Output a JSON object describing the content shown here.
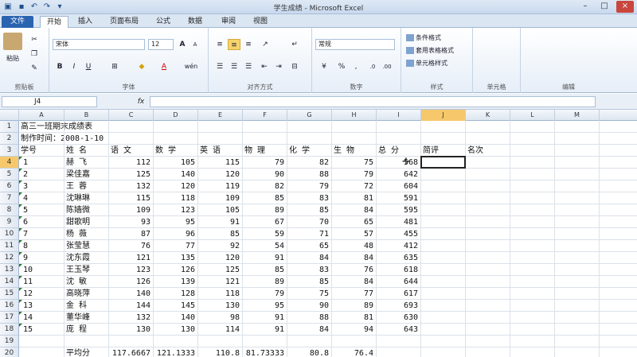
{
  "window": {
    "title": "学生成绩 - Microsoft Excel"
  },
  "tabs": [
    "文件",
    "开始",
    "插入",
    "页面布局",
    "公式",
    "数据",
    "审阅",
    "视图"
  ],
  "ribbon": {
    "clipboard": {
      "paste": "粘贴",
      "label": "剪贴板"
    },
    "font": {
      "name": "宋体",
      "size": "12",
      "bold": "B",
      "italic": "I",
      "underline": "U",
      "grow": "A",
      "shrink": "A",
      "label": "字体",
      "wen": "wén"
    },
    "alignment": {
      "label": "对齐方式"
    },
    "number": {
      "format": "常规",
      "percent": "%",
      "comma": ",",
      "label": "数字"
    },
    "styles": {
      "cond": "条件格式",
      "table": "套用表格格式",
      "cell": "单元格样式",
      "label": "样式"
    },
    "cells": {
      "label": "单元格"
    },
    "editing": {
      "label": "编辑"
    }
  },
  "formula_bar": {
    "name_box": "J4",
    "fx": "fx",
    "formula": ""
  },
  "columns": [
    "A",
    "B",
    "C",
    "D",
    "E",
    "F",
    "G",
    "H",
    "I",
    "J",
    "K",
    "L",
    "M"
  ],
  "rows": [
    {
      "n": "1",
      "A": "高三一班期末成绩表"
    },
    {
      "n": "2",
      "A": "制作时间：2008-1-10"
    },
    {
      "n": "3",
      "A": "学号",
      "B": "姓 名",
      "C": "语 文",
      "D": "数 学",
      "E": "英 语",
      "F": "物 理",
      "G": "化 学",
      "H": "生 物",
      "I": "总 分",
      "J": "简评",
      "K": "名次"
    },
    {
      "n": "4",
      "A": "1",
      "B": "赫  飞",
      "C": "112",
      "D": "105",
      "E": "115",
      "F": "79",
      "G": "82",
      "H": "75",
      "I": "568"
    },
    {
      "n": "5",
      "A": "2",
      "B": "梁佳嘉",
      "C": "125",
      "D": "140",
      "E": "120",
      "F": "90",
      "G": "88",
      "H": "79",
      "I": "642"
    },
    {
      "n": "6",
      "A": "3",
      "B": "王  蓉",
      "C": "132",
      "D": "120",
      "E": "119",
      "F": "82",
      "G": "79",
      "H": "72",
      "I": "604"
    },
    {
      "n": "7",
      "A": "4",
      "B": "沈琳琳",
      "C": "115",
      "D": "118",
      "E": "109",
      "F": "85",
      "G": "83",
      "H": "81",
      "I": "591"
    },
    {
      "n": "8",
      "A": "5",
      "B": "陈嫱微",
      "C": "109",
      "D": "123",
      "E": "105",
      "F": "89",
      "G": "85",
      "H": "84",
      "I": "595"
    },
    {
      "n": "9",
      "A": "6",
      "B": "甜歌明",
      "C": "93",
      "D": "95",
      "E": "91",
      "F": "67",
      "G": "70",
      "H": "65",
      "I": "481"
    },
    {
      "n": "10",
      "A": "7",
      "B": "杨  薇",
      "C": "87",
      "D": "96",
      "E": "85",
      "F": "59",
      "G": "71",
      "H": "57",
      "I": "455"
    },
    {
      "n": "11",
      "A": "8",
      "B": "张莹慧",
      "C": "76",
      "D": "77",
      "E": "92",
      "F": "54",
      "G": "65",
      "H": "48",
      "I": "412"
    },
    {
      "n": "12",
      "A": "9",
      "B": "沈东霞",
      "C": "121",
      "D": "135",
      "E": "120",
      "F": "91",
      "G": "84",
      "H": "84",
      "I": "635"
    },
    {
      "n": "13",
      "A": "10",
      "B": "王玉琴",
      "C": "123",
      "D": "126",
      "E": "125",
      "F": "85",
      "G": "83",
      "H": "76",
      "I": "618"
    },
    {
      "n": "14",
      "A": "11",
      "B": "沈  敏",
      "C": "126",
      "D": "139",
      "E": "121",
      "F": "89",
      "G": "85",
      "H": "84",
      "I": "644"
    },
    {
      "n": "15",
      "A": "12",
      "B": "高晓萍",
      "C": "140",
      "D": "128",
      "E": "118",
      "F": "79",
      "G": "75",
      "H": "77",
      "I": "617"
    },
    {
      "n": "16",
      "A": "13",
      "B": "金  科",
      "C": "144",
      "D": "145",
      "E": "130",
      "F": "95",
      "G": "90",
      "H": "89",
      "I": "693"
    },
    {
      "n": "17",
      "A": "14",
      "B": "董华峰",
      "C": "132",
      "D": "140",
      "E": "98",
      "F": "91",
      "G": "88",
      "H": "81",
      "I": "630"
    },
    {
      "n": "18",
      "A": "15",
      "B": "庞  程",
      "C": "130",
      "D": "130",
      "E": "114",
      "F": "91",
      "G": "84",
      "H": "94",
      "I": "643"
    },
    {
      "n": "19"
    },
    {
      "n": "20",
      "B": "平均分",
      "C": "117.6667",
      "D": "121.1333",
      "E": "110.8",
      "F": "81.73333",
      "G": "80.8",
      "H": "76.4"
    }
  ]
}
